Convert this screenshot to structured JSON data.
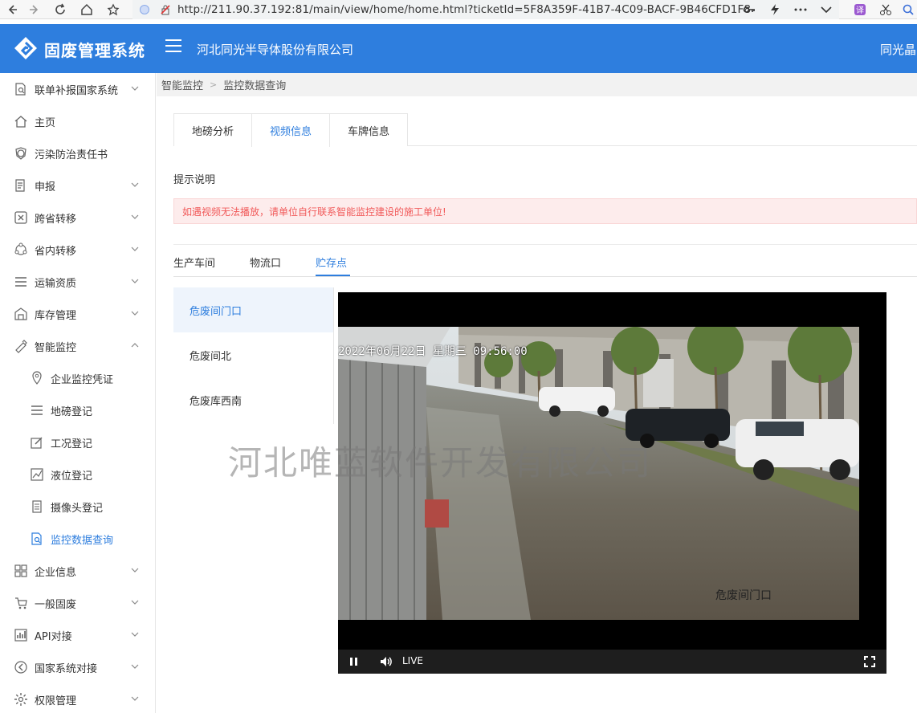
{
  "browser": {
    "url": "http://211.90.37.192:81/main/view/home/home.html?ticketId=5F8A359F-41B7-4C09-BACF-9B46CFD1F8"
  },
  "header": {
    "app_title": "固废管理系统",
    "company": "河北同光半导体股份有限公司",
    "user": "同光晶"
  },
  "sidebar": {
    "items": [
      {
        "label": "联单补报国家系统",
        "icon": "document-search-icon",
        "expandable": true
      },
      {
        "label": "主页",
        "icon": "home-icon",
        "expandable": false
      },
      {
        "label": "污染防治责任书",
        "icon": "medal-icon",
        "expandable": false
      },
      {
        "label": "申报",
        "icon": "edit-doc-icon",
        "expandable": true
      },
      {
        "label": "跨省转移",
        "icon": "cross-box-icon",
        "expandable": true
      },
      {
        "label": "省内转移",
        "icon": "cycle-icon",
        "expandable": true
      },
      {
        "label": "运输资质",
        "icon": "list-icon",
        "expandable": true
      },
      {
        "label": "库存管理",
        "icon": "warehouse-icon",
        "expandable": true
      },
      {
        "label": "智能监控",
        "icon": "monitor-icon",
        "expandable": true,
        "expanded": true
      }
    ],
    "sub_items": [
      {
        "label": "企业监控凭证",
        "icon": "location-icon"
      },
      {
        "label": "地磅登记",
        "icon": "list-icon"
      },
      {
        "label": "工况登记",
        "icon": "edit-icon"
      },
      {
        "label": "液位登记",
        "icon": "chart-icon"
      },
      {
        "label": "摄像头登记",
        "icon": "doc-icon"
      },
      {
        "label": "监控数据查询",
        "icon": "document-search-icon",
        "active": true
      }
    ],
    "bottom_items": [
      {
        "label": "企业信息",
        "icon": "grid-icon",
        "expandable": true
      },
      {
        "label": "一般固废",
        "icon": "cart-icon",
        "expandable": true
      },
      {
        "label": "API对接",
        "icon": "bar-chart-icon",
        "expandable": true
      },
      {
        "label": "国家系统对接",
        "icon": "circle-arrow-icon",
        "expandable": true
      },
      {
        "label": "权限管理",
        "icon": "gear-icon",
        "expandable": true
      }
    ]
  },
  "breadcrumb": [
    "智能监控",
    "监控数据查询"
  ],
  "tabs": [
    {
      "label": "地磅分析"
    },
    {
      "label": "视频信息",
      "active": true
    },
    {
      "label": "车牌信息"
    }
  ],
  "hint": {
    "title": "提示说明",
    "message": "如遇视频无法播放，请单位自行联系智能监控建设的施工单位!"
  },
  "subtabs": [
    {
      "label": "生产车间"
    },
    {
      "label": "物流口"
    },
    {
      "label": "贮存点",
      "active": true
    }
  ],
  "cameras": [
    {
      "label": "危废间门口",
      "active": true
    },
    {
      "label": "危废间北"
    },
    {
      "label": "危废库西南"
    }
  ],
  "player": {
    "osd_time": "2022年06月22日 星期三 09:56:00",
    "osd_name": "危废间门口",
    "live_label": "LIVE"
  },
  "watermark": "河北唯蓝软件开发有限公司"
}
